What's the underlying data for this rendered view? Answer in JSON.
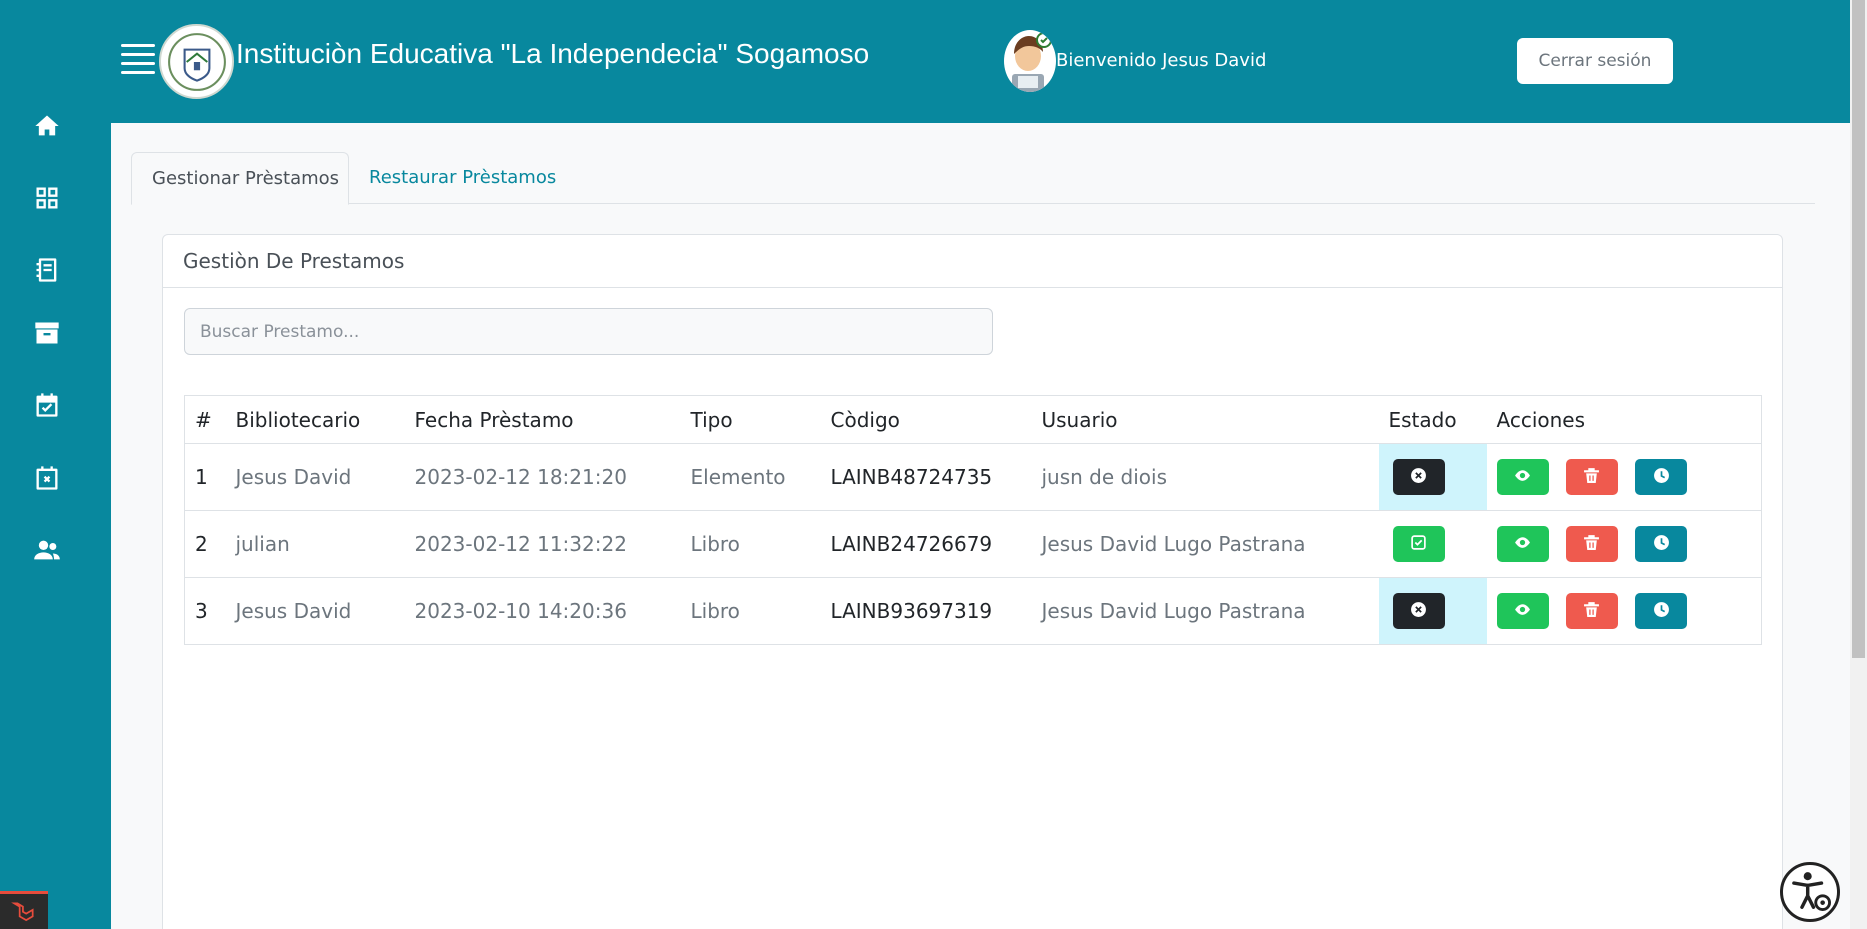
{
  "header": {
    "title": "Instituciòn Educativa \"La Independecia\" Sogamoso",
    "welcome": "Bienvenido Jesus David",
    "logout_label": "Cerrar sesión"
  },
  "sidebar": {
    "icons": [
      "home-icon",
      "grid-icon",
      "notebook-icon",
      "archive-icon",
      "calendar-check-icon",
      "calendar-x-icon",
      "users-icon"
    ]
  },
  "tabs": [
    {
      "label": "Gestionar Prèstamos",
      "active": true
    },
    {
      "label": "Restaurar Prèstamos",
      "active": false
    }
  ],
  "card": {
    "title": "Gestiòn De Prestamos",
    "search_placeholder": "Buscar Prestamo..."
  },
  "table": {
    "headers": [
      "#",
      "Bibliotecario",
      "Fecha Prèstamo",
      "Tipo",
      "Còdigo",
      "Usuario",
      "Estado",
      "Acciones"
    ],
    "rows": [
      {
        "num": "1",
        "bibliotecario": "Jesus David",
        "fecha": "2023-02-12 18:21:20",
        "tipo": "Elemento",
        "codigo": "LAINB48724735",
        "usuario": "jusn de diois",
        "estado": "pendiente"
      },
      {
        "num": "2",
        "bibliotecario": "julian",
        "fecha": "2023-02-12 11:32:22",
        "tipo": "Libro",
        "codigo": "LAINB24726679",
        "usuario": "Jesus David Lugo Pastrana",
        "estado": "devuelto"
      },
      {
        "num": "3",
        "bibliotecario": "Jesus David",
        "fecha": "2023-02-10 14:20:36",
        "tipo": "Libro",
        "codigo": "LAINB93697319",
        "usuario": "Jesus David Lugo Pastrana",
        "estado": "pendiente"
      }
    ]
  },
  "colors": {
    "primary": "#08889e",
    "success": "#1fc55a",
    "danger": "#ef5a4e",
    "dark": "#212529",
    "highlight": "#cff4fc"
  }
}
